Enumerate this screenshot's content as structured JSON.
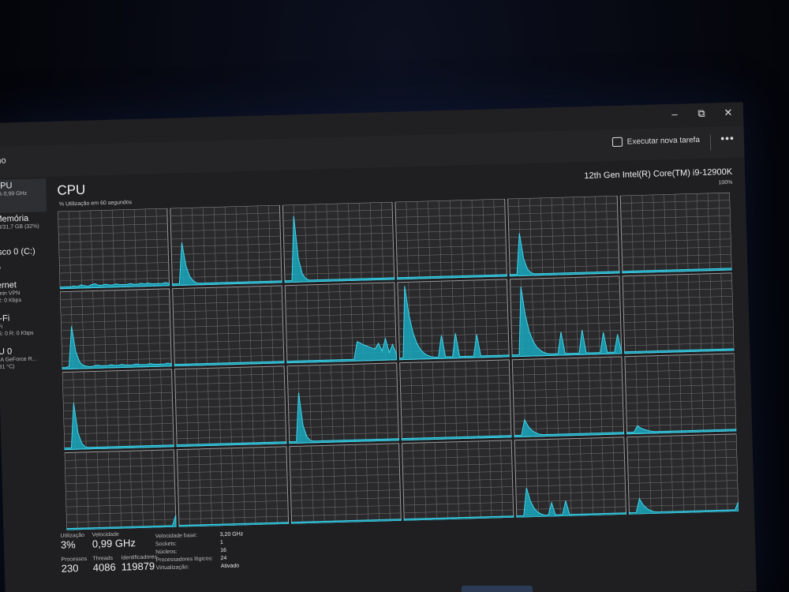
{
  "window": {
    "minimize_glyph": "–",
    "maximize_glyph": "⧉",
    "close_glyph": "✕"
  },
  "commandbar": {
    "title": "ho",
    "run_task_label": "Executar nova tarefa",
    "more_label": "•••"
  },
  "sidebar": {
    "items": [
      {
        "name": "CPU",
        "sub1": "3% 0,99 GHz",
        "sub2": ""
      },
      {
        "name": "Memória",
        "sub1": "13/31,7 GB (32%)",
        "sub2": ""
      },
      {
        "name": "isco 0 (C:)",
        "sub1": "D",
        "sub2": "%"
      },
      {
        "name": "ernet",
        "sub1": "lmin VPN",
        "sub2": "R: 0 Kbps"
      },
      {
        "name": "i-Fi",
        "sub1": "Fi",
        "sub2": "S: 0 R: 0 Kbps"
      },
      {
        "name": "U 0",
        "sub1": "IA GeForce R...",
        "sub2": "31 °C)"
      }
    ]
  },
  "main": {
    "title": "CPU",
    "subtitle": "% Utilização em 60 segundos",
    "model": "12th Gen Intel(R) Core(TM) i9-12900K",
    "max_label": "100%"
  },
  "graph_colors": {
    "line": "#3fd6ee",
    "fill": "#1aa7bd",
    "grid": "#6a6a6a",
    "border": "#9a9a9a",
    "bg": "#2a2a2c"
  },
  "core_graphs": [
    [
      0.02,
      0.02,
      0.02,
      0.02,
      0.03,
      0.02,
      0.04,
      0.03,
      0.02,
      0.04,
      0.05,
      0.03,
      0.03,
      0.04,
      0.03,
      0.03,
      0.04,
      0.03,
      0.03,
      0.03,
      0.04,
      0.03,
      0.03,
      0.04,
      0.03,
      0.04,
      0.03,
      0.03,
      0.03,
      0.03,
      0.04,
      0.03
    ],
    [
      0.02,
      0.02,
      0.02,
      0.02,
      0.02,
      0.02,
      0.02,
      0.02,
      0.02,
      0.02,
      0.02,
      0.02,
      0.02,
      0.02,
      0.02,
      0.02,
      0.02,
      0.02,
      0.02,
      0.02,
      0.02,
      0.02,
      0.02,
      0.02,
      0.02,
      0.02,
      0.02,
      0.02,
      0.02,
      0.02,
      0.02,
      0.02
    ],
    [
      0.02,
      0.02,
      0.02,
      0.02,
      0.02,
      0.02,
      0.02,
      0.02,
      0.02,
      0.02,
      0.02,
      0.02,
      0.02,
      0.02,
      0.02,
      0.02,
      0.02,
      0.02,
      0.02,
      0.02,
      0.02,
      0.02,
      0.02,
      0.02,
      0.02,
      0.02,
      0.02,
      0.02,
      0.02,
      0.02,
      0.02,
      0.02
    ],
    [
      0.02,
      0.02,
      0.02,
      0.02,
      0.02,
      0.02,
      0.02,
      0.02,
      0.02,
      0.02,
      0.02,
      0.02,
      0.02,
      0.02,
      0.02,
      0.02,
      0.02,
      0.02,
      0.02,
      0.02,
      0.02,
      0.02,
      0.02,
      0.02,
      0.02,
      0.02,
      0.02,
      0.02,
      0.02,
      0.02,
      0.02,
      0.02
    ],
    [
      0.02,
      0.02,
      0.02,
      0.02,
      0.02,
      0.02,
      0.02,
      0.02,
      0.02,
      0.02,
      0.02,
      0.02,
      0.02,
      0.02,
      0.02,
      0.02,
      0.02,
      0.02,
      0.02,
      0.02,
      0.02,
      0.02,
      0.02,
      0.02,
      0.02,
      0.02,
      0.02,
      0.02,
      0.02,
      0.02,
      0.02,
      0.02
    ],
    [
      0.02,
      0.02,
      0.02,
      0.02,
      0.02,
      0.02,
      0.02,
      0.02,
      0.02,
      0.02,
      0.02,
      0.02,
      0.02,
      0.02,
      0.02,
      0.02,
      0.02,
      0.02,
      0.02,
      0.02,
      0.02,
      0.02,
      0.02,
      0.02,
      0.02,
      0.02,
      0.02,
      0.02,
      0.02,
      0.02,
      0.02,
      0.02
    ],
    [
      0.02,
      0.02,
      0.03,
      0.02,
      0.03,
      0.03,
      0.04,
      0.03,
      0.02,
      0.03,
      0.04,
      0.03,
      0.03,
      0.03,
      0.04,
      0.03,
      0.03,
      0.04,
      0.03,
      0.03,
      0.03,
      0.04,
      0.03,
      0.03,
      0.03,
      0.04,
      0.03,
      0.03,
      0.03,
      0.03,
      0.04,
      0.03
    ],
    [
      0.02,
      0.02,
      0.02,
      0.02,
      0.02,
      0.02,
      0.02,
      0.02,
      0.02,
      0.02,
      0.02,
      0.02,
      0.02,
      0.02,
      0.02,
      0.02,
      0.02,
      0.02,
      0.02,
      0.02,
      0.02,
      0.02,
      0.02,
      0.02,
      0.02,
      0.02,
      0.02,
      0.02,
      0.02,
      0.02,
      0.02,
      0.02
    ],
    [
      0.02,
      0.02,
      0.02,
      0.02,
      0.02,
      0.02,
      0.02,
      0.02,
      0.02,
      0.02,
      0.02,
      0.02,
      0.02,
      0.02,
      0.02,
      0.02,
      0.02,
      0.02,
      0.02,
      0.02,
      0.02,
      0.02,
      0.02,
      0.02,
      0.02,
      0.02,
      0.02,
      0.02,
      0.02,
      0.02,
      0.02,
      0.02
    ],
    [
      0.02,
      0.02,
      0.02,
      0.02,
      0.02,
      0.02,
      0.02,
      0.02,
      0.02,
      0.02,
      0.02,
      0.02,
      0.02,
      0.02,
      0.02,
      0.02,
      0.02,
      0.02,
      0.02,
      0.02,
      0.02,
      0.02,
      0.02,
      0.02,
      0.02,
      0.02,
      0.02,
      0.02,
      0.02,
      0.02,
      0.02,
      0.02
    ],
    [
      0.02,
      0.02,
      0.02,
      0.02,
      0.02,
      0.02,
      0.02,
      0.02,
      0.02,
      0.02,
      0.02,
      0.02,
      0.02,
      0.02,
      0.02,
      0.02,
      0.02,
      0.02,
      0.02,
      0.02,
      0.02,
      0.02,
      0.02,
      0.02,
      0.02,
      0.02,
      0.02,
      0.02,
      0.02,
      0.02,
      0.02,
      0.02
    ],
    [
      0.02,
      0.02,
      0.02,
      0.02,
      0.02,
      0.02,
      0.02,
      0.02,
      0.02,
      0.02,
      0.02,
      0.02,
      0.02,
      0.02,
      0.02,
      0.02,
      0.02,
      0.02,
      0.02,
      0.02,
      0.02,
      0.02,
      0.02,
      0.02,
      0.02,
      0.02,
      0.02,
      0.02,
      0.02,
      0.02,
      0.02,
      0.02
    ],
    [
      0.02,
      0.02,
      0.02,
      0.02,
      0.02,
      0.02,
      0.02,
      0.02,
      0.02,
      0.02,
      0.02,
      0.02,
      0.02,
      0.02,
      0.02,
      0.02,
      0.02,
      0.02,
      0.02,
      0.02,
      0.02,
      0.02,
      0.02,
      0.02,
      0.02,
      0.02,
      0.02,
      0.02,
      0.02,
      0.02,
      0.02,
      0.02
    ],
    [
      0.02,
      0.02,
      0.02,
      0.02,
      0.02,
      0.02,
      0.02,
      0.02,
      0.02,
      0.02,
      0.02,
      0.02,
      0.02,
      0.02,
      0.02,
      0.02,
      0.02,
      0.02,
      0.02,
      0.02,
      0.02,
      0.02,
      0.02,
      0.02,
      0.02,
      0.02,
      0.02,
      0.02,
      0.02,
      0.02,
      0.02,
      0.02
    ],
    [
      0.02,
      0.02,
      0.02,
      0.02,
      0.02,
      0.02,
      0.02,
      0.02,
      0.02,
      0.02,
      0.02,
      0.02,
      0.02,
      0.02,
      0.02,
      0.02,
      0.02,
      0.02,
      0.02,
      0.02,
      0.02,
      0.02,
      0.02,
      0.02,
      0.02,
      0.02,
      0.02,
      0.02,
      0.02,
      0.02,
      0.02,
      0.02
    ],
    [
      0.02,
      0.02,
      0.02,
      0.02,
      0.02,
      0.02,
      0.02,
      0.02,
      0.02,
      0.02,
      0.02,
      0.02,
      0.02,
      0.02,
      0.02,
      0.02,
      0.02,
      0.02,
      0.02,
      0.02,
      0.02,
      0.02,
      0.02,
      0.02,
      0.02,
      0.02,
      0.02,
      0.02,
      0.02,
      0.02,
      0.02,
      0.02
    ],
    [
      0.02,
      0.02,
      0.02,
      0.02,
      0.02,
      0.02,
      0.02,
      0.02,
      0.02,
      0.02,
      0.02,
      0.02,
      0.02,
      0.02,
      0.02,
      0.02,
      0.02,
      0.02,
      0.02,
      0.02,
      0.02,
      0.02,
      0.02,
      0.02,
      0.02,
      0.02,
      0.02,
      0.02,
      0.02,
      0.02,
      0.02,
      0.02
    ],
    [
      0.02,
      0.02,
      0.02,
      0.02,
      0.02,
      0.02,
      0.02,
      0.02,
      0.02,
      0.02,
      0.02,
      0.02,
      0.02,
      0.02,
      0.02,
      0.02,
      0.02,
      0.02,
      0.02,
      0.02,
      0.02,
      0.02,
      0.02,
      0.02,
      0.02,
      0.02,
      0.02,
      0.02,
      0.02,
      0.02,
      0.02,
      0.02
    ],
    [
      0.02,
      0.02,
      0.02,
      0.02,
      0.02,
      0.02,
      0.02,
      0.02,
      0.02,
      0.02,
      0.02,
      0.02,
      0.02,
      0.02,
      0.02,
      0.02,
      0.02,
      0.02,
      0.02,
      0.02,
      0.02,
      0.02,
      0.02,
      0.02,
      0.02,
      0.02,
      0.02,
      0.02,
      0.02,
      0.02,
      0.02,
      0.02
    ],
    [
      0.02,
      0.02,
      0.02,
      0.02,
      0.02,
      0.02,
      0.02,
      0.02,
      0.02,
      0.02,
      0.02,
      0.02,
      0.02,
      0.02,
      0.02,
      0.02,
      0.02,
      0.02,
      0.02,
      0.02,
      0.02,
      0.02,
      0.02,
      0.02,
      0.02,
      0.02,
      0.02,
      0.02,
      0.02,
      0.02,
      0.02,
      0.02
    ],
    [
      0.02,
      0.02,
      0.02,
      0.02,
      0.02,
      0.02,
      0.02,
      0.02,
      0.02,
      0.02,
      0.02,
      0.02,
      0.02,
      0.02,
      0.02,
      0.02,
      0.02,
      0.02,
      0.02,
      0.02,
      0.02,
      0.02,
      0.02,
      0.02,
      0.02,
      0.02,
      0.02,
      0.02,
      0.02,
      0.02,
      0.02,
      0.02
    ],
    [
      0.02,
      0.02,
      0.02,
      0.02,
      0.02,
      0.02,
      0.02,
      0.02,
      0.02,
      0.02,
      0.02,
      0.02,
      0.02,
      0.02,
      0.02,
      0.02,
      0.02,
      0.02,
      0.02,
      0.02,
      0.02,
      0.02,
      0.02,
      0.02,
      0.02,
      0.02,
      0.02,
      0.02,
      0.02,
      0.02,
      0.02,
      0.02
    ],
    [
      0.02,
      0.02,
      0.02,
      0.02,
      0.02,
      0.02,
      0.02,
      0.02,
      0.02,
      0.02,
      0.02,
      0.02,
      0.02,
      0.02,
      0.02,
      0.02,
      0.02,
      0.02,
      0.02,
      0.02,
      0.02,
      0.02,
      0.02,
      0.02,
      0.02,
      0.02,
      0.02,
      0.02,
      0.02,
      0.02,
      0.02,
      0.02
    ],
    [
      0.02,
      0.02,
      0.02,
      0.02,
      0.02,
      0.02,
      0.02,
      0.02,
      0.02,
      0.02,
      0.02,
      0.02,
      0.02,
      0.02,
      0.02,
      0.02,
      0.02,
      0.02,
      0.02,
      0.02,
      0.02,
      0.02,
      0.02,
      0.02,
      0.02,
      0.02,
      0.02,
      0.02,
      0.02,
      0.02,
      0.02,
      0.02
    ]
  ],
  "stats": {
    "utilization_label": "Utilização",
    "utilization_value": "3%",
    "speed_label": "Velocidade",
    "speed_value": "0,99 GHz",
    "processes_label": "Processos",
    "processes_value": "230",
    "threads_label": "Threads",
    "threads_value": "4086",
    "handles_label": "Identificadores",
    "handles_value": "119879",
    "details": [
      {
        "key": "Velocidade base:",
        "value": "3,20 GHz"
      },
      {
        "key": "Sockets:",
        "value": "1"
      },
      {
        "key": "Núcleos:",
        "value": "16"
      },
      {
        "key": "Processadores lógicos:",
        "value": "24"
      },
      {
        "key": "Virtualização:",
        "value": "Ativado"
      }
    ]
  }
}
